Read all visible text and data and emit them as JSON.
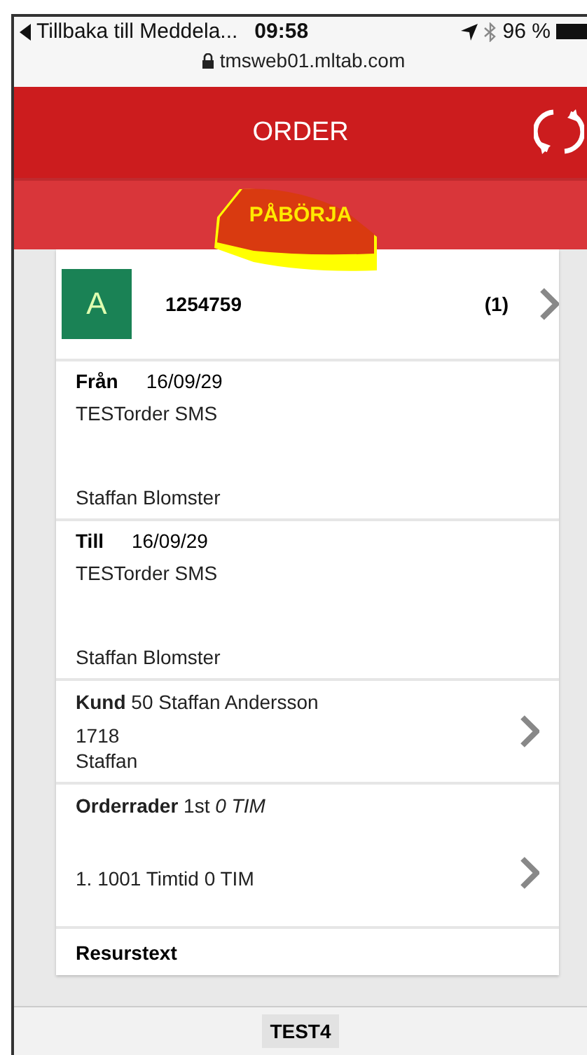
{
  "status_bar": {
    "back_label": "Tillbaka till Meddela...",
    "time": "09:58",
    "battery": "96 %",
    "url": "tmsweb01.mltab.com"
  },
  "header": {
    "title": "ORDER"
  },
  "action": {
    "label": "PÅBÖRJA"
  },
  "order": {
    "badge": "A",
    "number": "1254759",
    "count": "(1)"
  },
  "stops": [
    {
      "label": "Från",
      "date": "16/09/29",
      "lines": [
        "TESTorder SMS",
        "Staffan Blomster"
      ]
    },
    {
      "label": "Till",
      "date": "16/09/29",
      "lines": [
        "TESTorder SMS",
        "Staffan Blomster"
      ]
    }
  ],
  "customer": {
    "heading": "**Kund** 50 Staffan Andersson",
    "lines": [
      "1718",
      "Staffan"
    ]
  },
  "order_rows": {
    "heading": "**Orderrader** 1st *0 TIM*",
    "rows": [
      "1. 1001 Timtid 0 TIM"
    ]
  },
  "resource": {
    "label": "Resurstext"
  },
  "footer": {
    "label": "TEST4"
  }
}
